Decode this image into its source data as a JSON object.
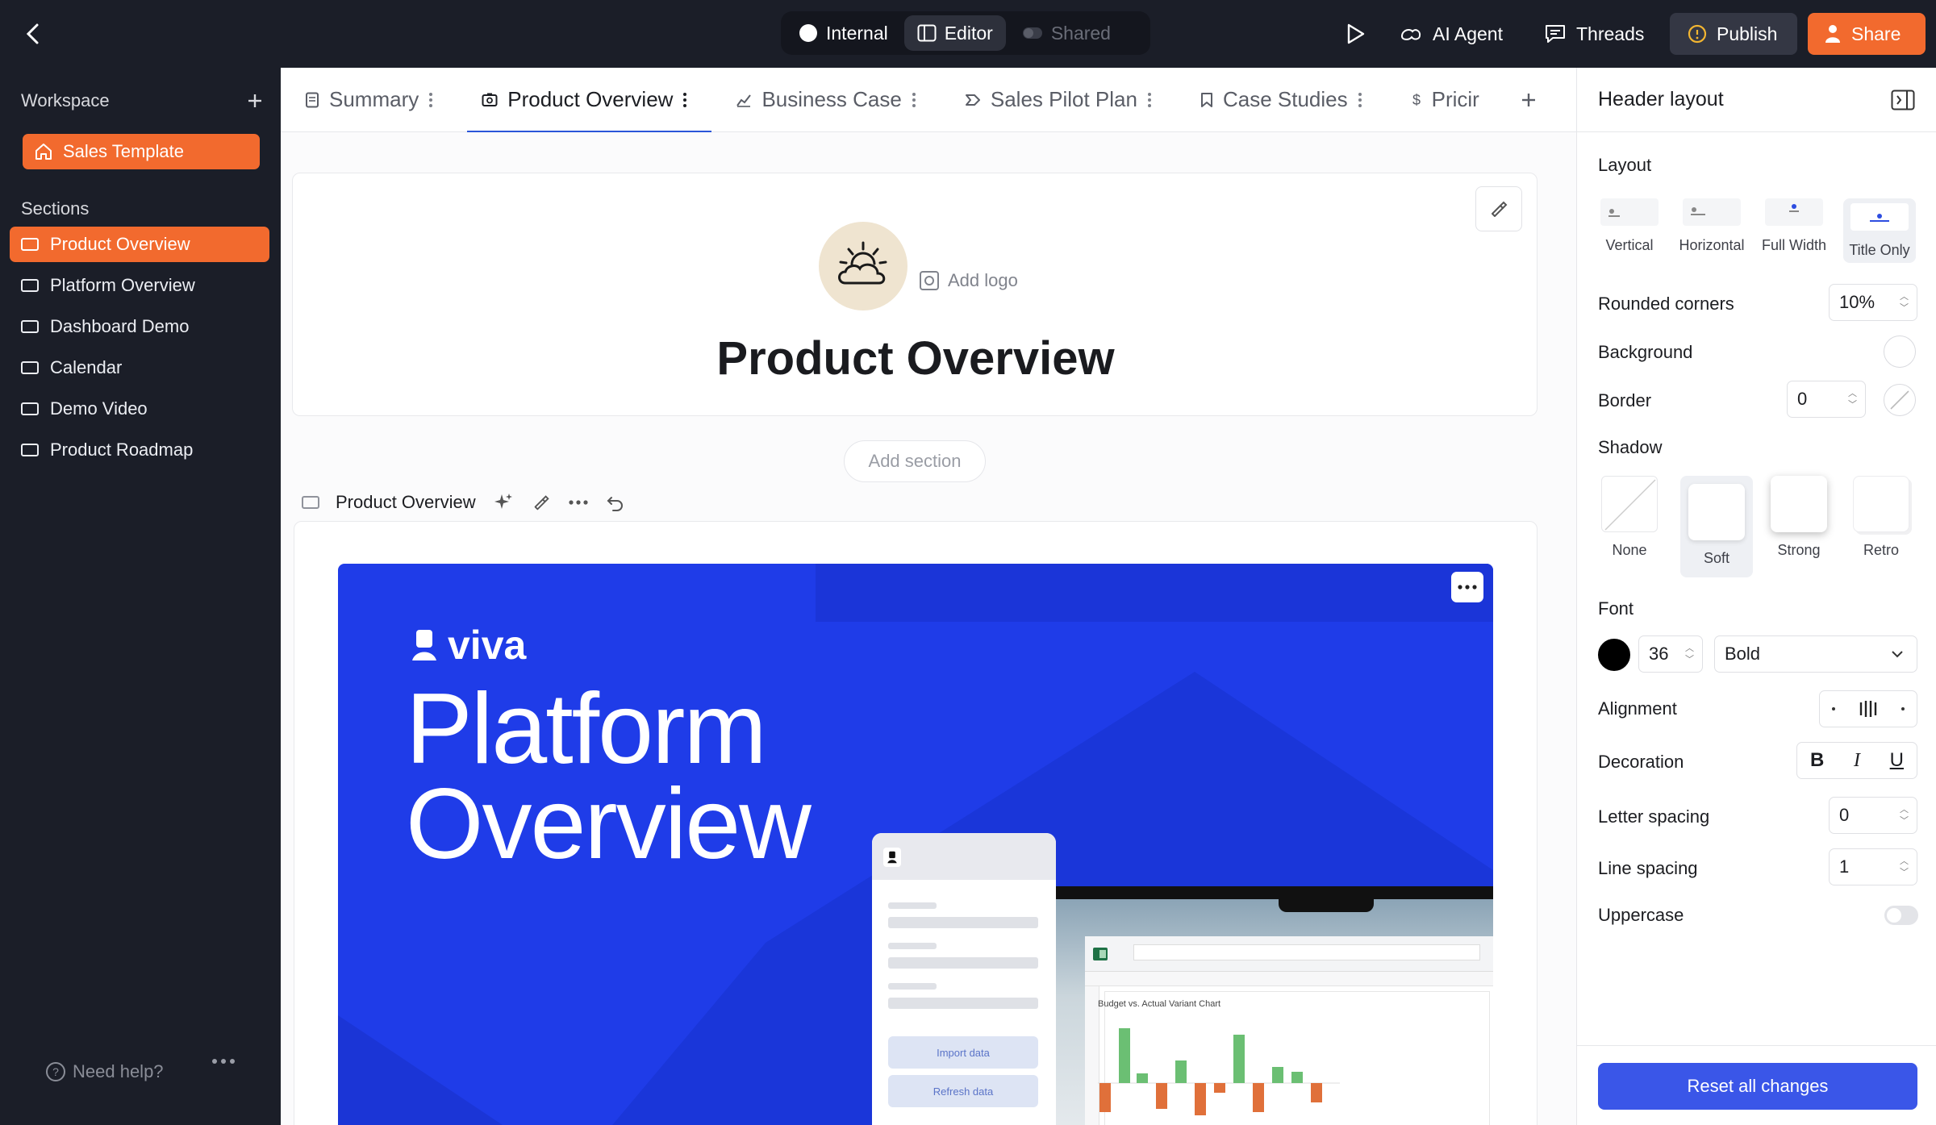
{
  "topbar": {
    "modes": [
      {
        "label": "Internal",
        "icon": "circle-filled-icon"
      },
      {
        "label": "Editor",
        "icon": "panel-icon"
      },
      {
        "label": "Shared",
        "icon": "toggle-icon"
      }
    ],
    "ai_agent": "AI Agent",
    "threads": "Threads",
    "publish": "Publish",
    "share": "Share"
  },
  "sidebar": {
    "workspace_label": "Workspace",
    "template": "Sales Template",
    "sections_label": "Sections",
    "items": [
      {
        "label": "Product Overview"
      },
      {
        "label": "Platform Overview"
      },
      {
        "label": "Dashboard Demo"
      },
      {
        "label": "Calendar"
      },
      {
        "label": "Demo Video"
      },
      {
        "label": "Product Roadmap"
      }
    ],
    "help": "Need help?"
  },
  "tabs": [
    {
      "label": "Summary"
    },
    {
      "label": "Product Overview"
    },
    {
      "label": "Business Case"
    },
    {
      "label": "Sales Pilot Plan"
    },
    {
      "label": "Case Studies"
    },
    {
      "label": "Pricir"
    }
  ],
  "header_card": {
    "add_logo": "Add logo",
    "title": "Product Overview"
  },
  "add_section": "Add section",
  "section_toolbar": {
    "title": "Product Overview"
  },
  "slide": {
    "brand": "viva",
    "title_line1": "Platform",
    "title_line2": "Overview",
    "import_data": "Import data",
    "refresh_data": "Refresh data",
    "chart_title": "Budget vs. Actual Variant Chart"
  },
  "right_panel": {
    "title": "Header layout",
    "layout_label": "Layout",
    "layout_options": [
      "Vertical",
      "Horizontal",
      "Full Width",
      "Title Only"
    ],
    "rounded_corners_label": "Rounded corners",
    "rounded_corners_value": "10%",
    "background_label": "Background",
    "border_label": "Border",
    "border_value": "0",
    "shadow_label": "Shadow",
    "shadow_options": [
      "None",
      "Soft",
      "Strong",
      "Retro"
    ],
    "font_label": "Font",
    "font_size": "36",
    "font_weight": "Bold",
    "alignment_label": "Alignment",
    "decoration_label": "Decoration",
    "decoration": [
      "B",
      "I",
      "U"
    ],
    "letter_spacing_label": "Letter spacing",
    "letter_spacing_value": "0",
    "line_spacing_label": "Line spacing",
    "line_spacing_value": "1",
    "uppercase_label": "Uppercase",
    "reset": "Reset all changes"
  },
  "colors": {
    "accent": "#f26a2e",
    "primary": "#3a56e8",
    "slide_blue": "#1f3ce8",
    "dark": "#1b1e28"
  }
}
